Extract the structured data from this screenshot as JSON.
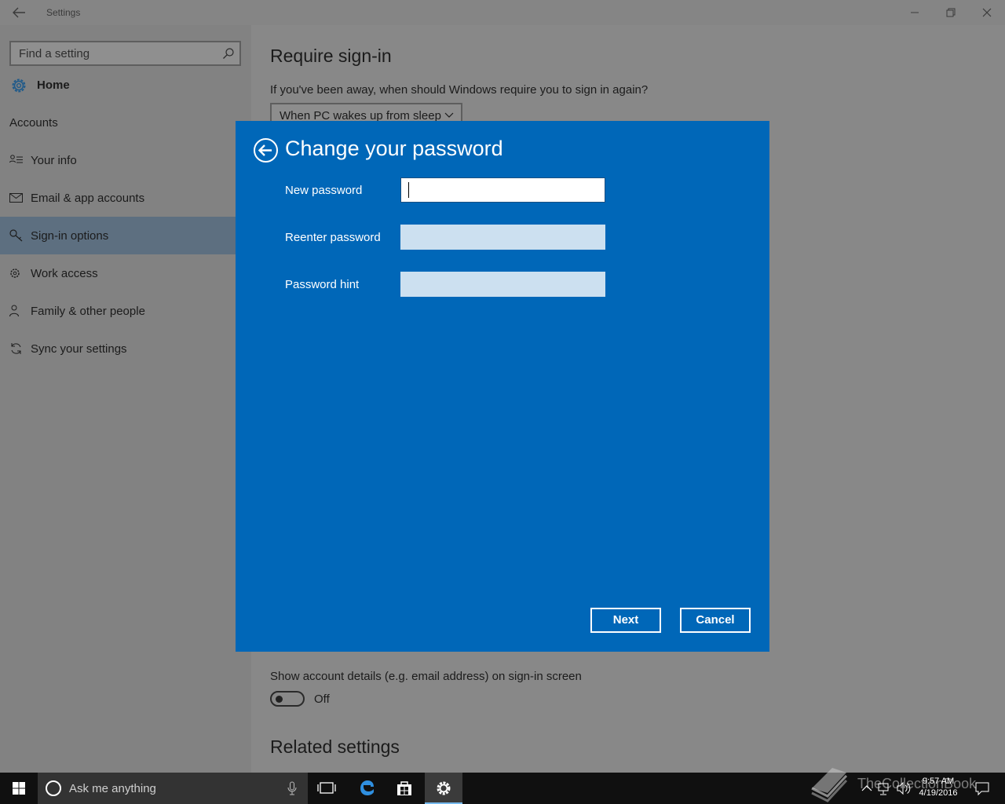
{
  "window": {
    "title": "Settings"
  },
  "sidebar": {
    "search_placeholder": "Find a setting",
    "home_label": "Home",
    "section_label": "Accounts",
    "items": [
      {
        "label": "Your info",
        "icon": "person-card-icon"
      },
      {
        "label": "Email & app accounts",
        "icon": "mail-icon"
      },
      {
        "label": "Sign-in options",
        "icon": "key-icon",
        "active": true
      },
      {
        "label": "Work access",
        "icon": "briefcase-gear-icon"
      },
      {
        "label": "Family & other people",
        "icon": "people-icon"
      },
      {
        "label": "Sync your settings",
        "icon": "sync-icon"
      }
    ]
  },
  "content": {
    "require_title": "Require sign-in",
    "require_question": "If you've been away, when should Windows require you to sign in again?",
    "require_value": "When PC wakes up from sleep",
    "account_details": "Show account details (e.g. email address) on sign-in screen",
    "toggle_state": "Off",
    "related_title": "Related settings"
  },
  "dialog": {
    "title": "Change your password",
    "new_password_label": "New password",
    "reenter_label": "Reenter password",
    "hint_label": "Password hint",
    "next_label": "Next",
    "cancel_label": "Cancel",
    "bg_color": "#0067b8"
  },
  "taskbar": {
    "search_text": "Ask me anything",
    "time": "9:57 AM",
    "date": "4/19/2016"
  },
  "watermark": {
    "text": "TheCollectionBook"
  }
}
